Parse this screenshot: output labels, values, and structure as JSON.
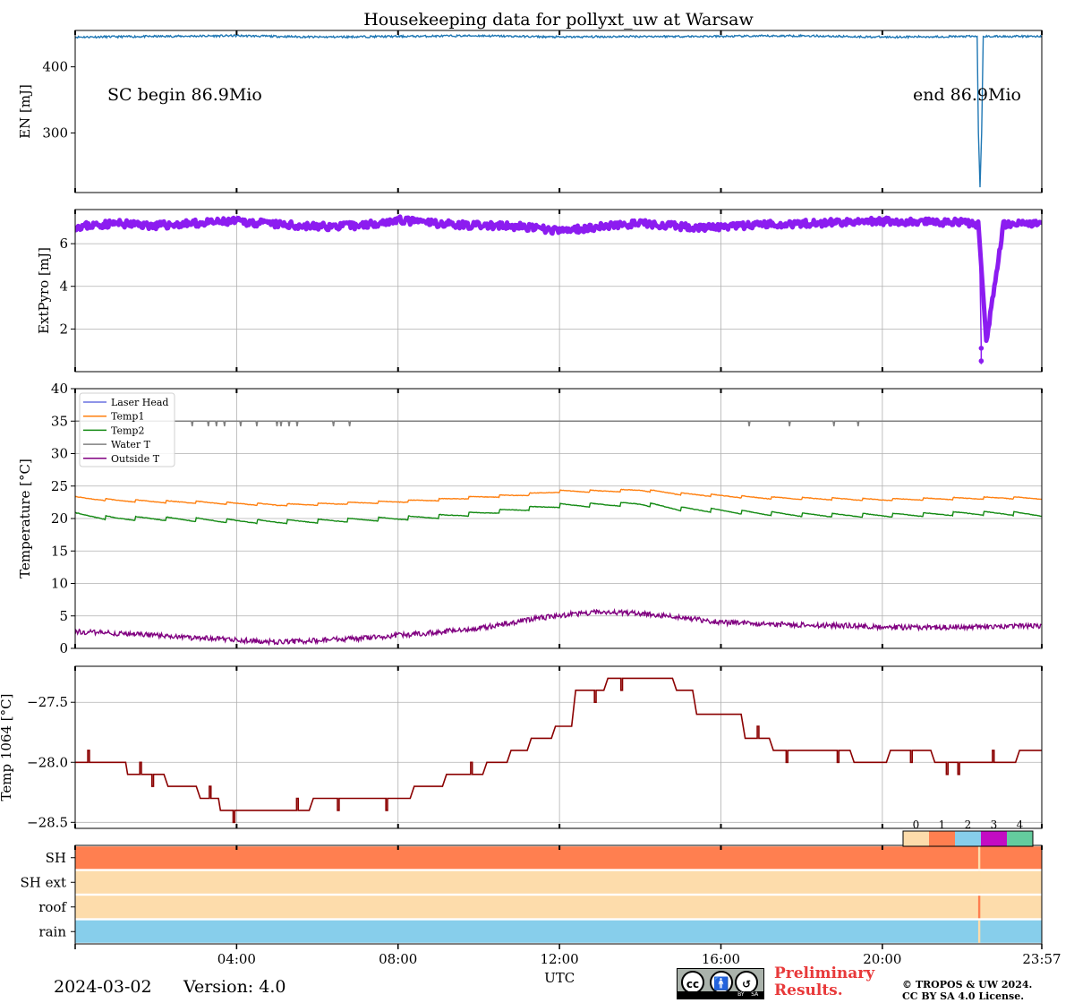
{
  "title": "Housekeeping data for pollyxt_uw at Warsaw",
  "date_label": "2024-03-02",
  "version_label": "Version: 4.0",
  "preliminary_line1": "Preliminary",
  "preliminary_line2": "Results.",
  "copyright_line1": "© TROPOS & UW 2024.",
  "copyright_line2": "CC BY SA 4.0 License.",
  "cc_badge": {
    "cc": "cc",
    "by": "BY",
    "sa": "SA"
  },
  "chart_data": [
    {
      "id": "energy",
      "type": "line",
      "ylabel": "EN [mJ]",
      "x_unit": "hours UTC",
      "ylim": [
        210,
        455
      ],
      "yticks": [
        300,
        400
      ],
      "grid": false,
      "annotation_left": "SC begin 86.9Mio",
      "annotation_right": "end 86.9Mio",
      "color": "#1f77b4",
      "series": [
        {
          "x": [
            0,
            2,
            4,
            6,
            8,
            10,
            12,
            14,
            16,
            18,
            20,
            22.35,
            22.38,
            22.42,
            22.46,
            22.5,
            23.95
          ],
          "y": [
            445,
            446,
            447,
            445,
            446,
            447,
            445,
            446,
            446,
            447,
            445,
            446,
            300,
            218,
            300,
            446,
            446
          ]
        }
      ]
    },
    {
      "id": "extpyro",
      "type": "line",
      "ylabel": "ExtPyro [mJ]",
      "ylim": [
        0,
        7.6
      ],
      "yticks": [
        2,
        4,
        6
      ],
      "grid": true,
      "color": "#8c1cf0",
      "series": [
        {
          "x": [
            0,
            1,
            2,
            3,
            4,
            5,
            6,
            7,
            8,
            9,
            10,
            11,
            12,
            13,
            14,
            15,
            16,
            17,
            18,
            19,
            20,
            21,
            22,
            22.4,
            22.45,
            22.5,
            23,
            23.95
          ],
          "y": [
            6.8,
            6.95,
            6.85,
            6.95,
            7.05,
            6.9,
            6.8,
            6.85,
            7.1,
            6.95,
            6.85,
            6.8,
            6.6,
            6.8,
            6.95,
            6.8,
            6.75,
            6.9,
            6.95,
            7.0,
            7.05,
            7.0,
            7.0,
            6.9,
            1.1,
            0.35,
            6.9,
            7.0
          ]
        }
      ]
    },
    {
      "id": "temperature",
      "type": "line",
      "ylabel": "Temperature [$^\\circ C$]",
      "ylim": [
        0,
        40
      ],
      "yticks": [
        0,
        5,
        10,
        15,
        20,
        25,
        30,
        35,
        40
      ],
      "grid": true,
      "legend_position": "top-left",
      "series": [
        {
          "name": "Laser Head",
          "color": "#6a70e0",
          "x": [],
          "y": []
        },
        {
          "name": "Temp1",
          "color": "#ff7f0e",
          "x": [
            0,
            1,
            2,
            3,
            4,
            5,
            6,
            7,
            8,
            9,
            10,
            11,
            12,
            13,
            14,
            15,
            16,
            17,
            18,
            19,
            20,
            21,
            22,
            23,
            23.95
          ],
          "y": [
            23.2,
            22.8,
            22.6,
            22.5,
            22.3,
            22.1,
            22.2,
            22.4,
            22.6,
            22.9,
            23.3,
            23.6,
            24.2,
            24.2,
            24.4,
            23.8,
            23.5,
            23.2,
            23.1,
            23.0,
            22.9,
            23.0,
            23.1,
            23.2,
            23.1
          ]
        },
        {
          "name": "Temp2",
          "color": "#138a13",
          "x": [
            0,
            1,
            2,
            3,
            4,
            5,
            6,
            7,
            8,
            9,
            10,
            11,
            12,
            13,
            14,
            15,
            16,
            17,
            18,
            19,
            20,
            21,
            22,
            23,
            23.95
          ],
          "y": [
            20.6,
            20.0,
            20.0,
            19.8,
            19.6,
            19.5,
            19.6,
            19.8,
            20.0,
            20.3,
            20.8,
            21.4,
            22.0,
            22.1,
            22.3,
            21.5,
            21.2,
            20.8,
            20.6,
            20.5,
            20.5,
            20.6,
            20.8,
            20.8,
            20.6
          ]
        },
        {
          "name": "Water T",
          "color": "#808080",
          "x": [
            0,
            23.95
          ],
          "y": [
            35,
            35
          ],
          "dips_x": [
            2.9,
            3.3,
            3.5,
            3.7,
            4.1,
            4.5,
            5.0,
            5.1,
            5.3,
            5.5,
            6.4,
            6.8,
            16.7,
            17.7,
            18.8,
            19.4
          ],
          "dip_to": 34.2
        },
        {
          "name": "Outside T",
          "color": "#800080",
          "x": [
            0,
            1,
            2,
            3,
            4,
            5,
            6,
            7,
            8,
            9,
            10,
            11,
            12,
            13,
            14,
            15,
            16,
            17,
            18,
            19,
            20,
            21,
            22,
            23,
            23.95
          ],
          "y": [
            2.6,
            2.3,
            2.0,
            1.6,
            1.3,
            1.0,
            1.2,
            1.5,
            2.0,
            2.5,
            3.1,
            4.2,
            5.1,
            5.6,
            5.4,
            4.8,
            4.0,
            3.8,
            3.6,
            3.5,
            3.3,
            3.2,
            3.3,
            3.4,
            3.5
          ]
        }
      ]
    },
    {
      "id": "temp1064",
      "type": "line",
      "ylabel": "Temp 1064 [$^\\circ C$]",
      "ylim": [
        -28.55,
        -27.2
      ],
      "yticks": [
        -28.5,
        -28.0,
        -27.5
      ],
      "ytick_labels": [
        "−28.5",
        "−28.0",
        "−27.5"
      ],
      "grid": true,
      "color": "#8b0000",
      "series": [
        {
          "x": [
            0,
            1.25,
            1.3,
            2.2,
            2.3,
            3.0,
            3.1,
            3.55,
            3.6,
            5.8,
            5.9,
            8.3,
            8.4,
            9.1,
            9.2,
            10.1,
            10.2,
            10.7,
            10.8,
            11.2,
            11.3,
            11.8,
            11.9,
            12.3,
            12.4,
            13.1,
            13.2,
            14.8,
            14.9,
            15.3,
            15.4,
            16.5,
            16.6,
            17.2,
            17.3,
            19.2,
            19.3,
            20.1,
            20.2,
            21.2,
            21.3,
            23.3,
            23.4,
            23.95
          ],
          "y": [
            -28.0,
            -28.0,
            -28.1,
            -28.1,
            -28.2,
            -28.2,
            -28.3,
            -28.3,
            -28.4,
            -28.4,
            -28.3,
            -28.3,
            -28.2,
            -28.2,
            -28.1,
            -28.1,
            -28.0,
            -28.0,
            -27.9,
            -27.9,
            -27.8,
            -27.8,
            -27.7,
            -27.7,
            -27.4,
            -27.4,
            -27.3,
            -27.3,
            -27.4,
            -27.4,
            -27.6,
            -27.6,
            -27.8,
            -27.8,
            -27.9,
            -27.9,
            -28.0,
            -28.0,
            -27.9,
            -27.9,
            -28.0,
            -28.0,
            -27.9,
            -27.9
          ]
        }
      ]
    },
    {
      "id": "status",
      "type": "heatmap",
      "rows": [
        "SH",
        "SH ext",
        "roof",
        "rain"
      ],
      "colorbar_ticks": [
        "0",
        "1",
        "2",
        "3",
        "4"
      ],
      "colorbar_colors": [
        "#fddcab",
        "#ff7f50",
        "#87ceeb",
        "#c30cc3",
        "#64cc9e"
      ],
      "row_values": [
        1,
        0,
        0,
        2
      ],
      "event_x": 22.4,
      "event_values": [
        0,
        0,
        1,
        0
      ],
      "xlabel": "UTC",
      "xlim": [
        0,
        23.95
      ],
      "xticks": [
        4,
        8,
        12,
        16,
        20,
        23.95
      ],
      "xtick_labels": [
        "04:00",
        "08:00",
        "12:00",
        "16:00",
        "20:00",
        "23:57"
      ]
    }
  ]
}
